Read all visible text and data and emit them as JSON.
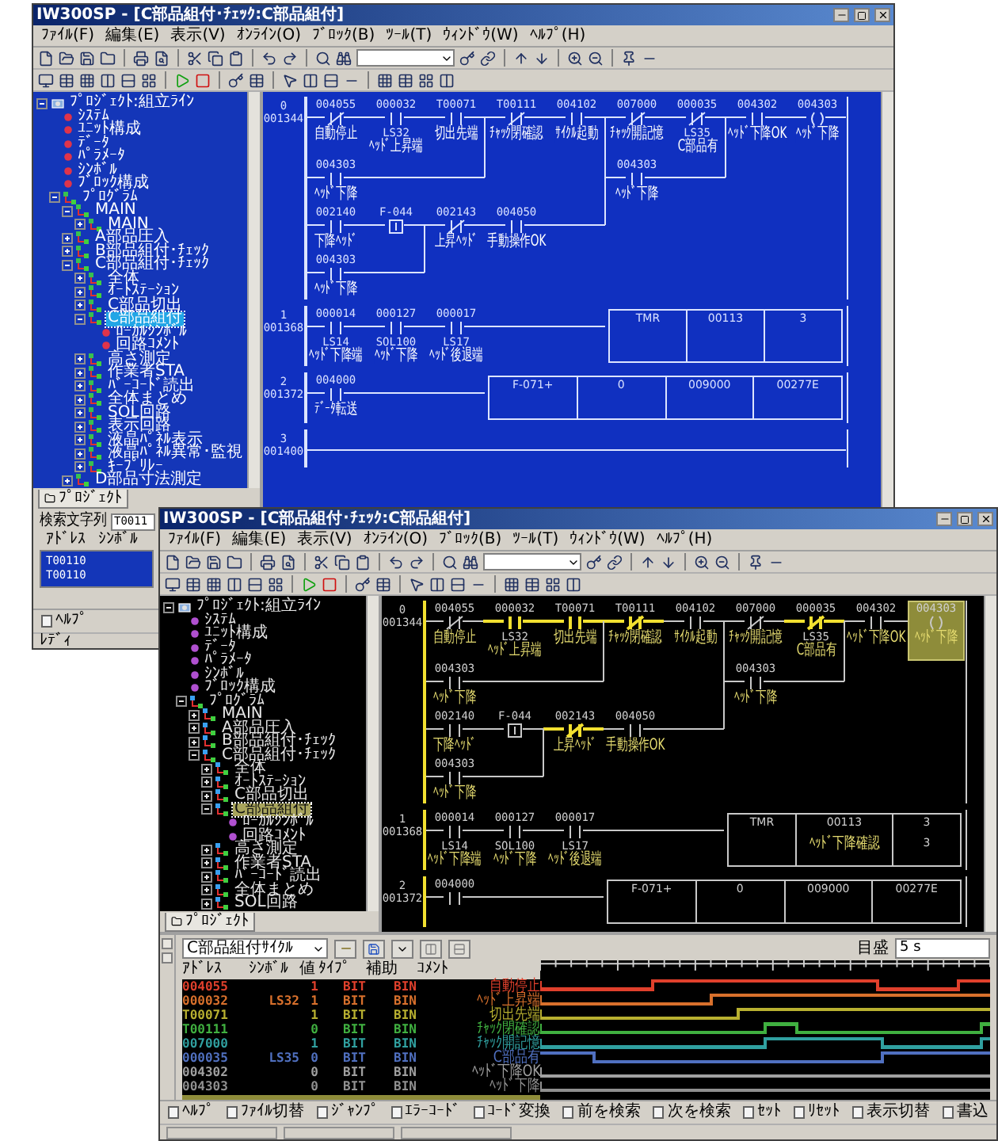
{
  "back": {
    "title": "IW300SP - [C部品組付･ﾁｪｯｸ:C部品組付]",
    "menu": [
      "ﾌｧｲﾙ(F)",
      "編集(E)",
      "表示(V)",
      "ｵﾝﾗｲﾝ(O)",
      "ﾌﾞﾛｯｸ(B)",
      "ﾂｰﾙ(T)",
      "ｳｨﾝﾄﾞｳ(W)",
      "ﾍﾙﾌﾟ(H)"
    ],
    "tree": {
      "label": "ﾌﾟﾛｼﾞｪｸﾄ:組立ﾗｲﾝ",
      "kind": "project",
      "expanded": true,
      "selected": false,
      "children": [
        {
          "label": "ｼｽﾃﾑ",
          "kind": "doc",
          "selected": false
        },
        {
          "label": "ﾕﾆｯﾄ構成",
          "kind": "doc",
          "selected": false
        },
        {
          "label": "ﾃﾞｰﾀ",
          "kind": "doc",
          "selected": false
        },
        {
          "label": "ﾊﾟﾗﾒｰﾀ",
          "kind": "doc",
          "selected": false
        },
        {
          "label": "ｼﾝﾎﾞﾙ",
          "kind": "doc",
          "selected": false
        },
        {
          "label": "ﾌﾞﾛｯｸ構成",
          "kind": "doc",
          "selected": false
        },
        {
          "label": "ﾌﾟﾛｸﾞﾗﾑ",
          "kind": "block",
          "expanded": true,
          "selected": false,
          "children": [
            {
              "label": "MAIN",
              "kind": "block",
              "expanded": true,
              "selected": false,
              "children": [
                {
                  "label": "MAIN",
                  "kind": "block",
                  "expanded": false,
                  "selected": false
                }
              ]
            },
            {
              "label": "A部品圧入",
              "kind": "block",
              "expanded": false,
              "selected": false
            },
            {
              "label": "B部品組付･ﾁｪｯｸ",
              "kind": "block",
              "expanded": false,
              "selected": false
            },
            {
              "label": "C部品組付･ﾁｪｯｸ",
              "kind": "block",
              "expanded": true,
              "selected": false,
              "children": [
                {
                  "label": "全体",
                  "kind": "block",
                  "expanded": false,
                  "selected": false
                },
                {
                  "label": "ｵｰﾄｽﾃｰｼｮﾝ",
                  "kind": "block",
                  "expanded": false,
                  "selected": false
                },
                {
                  "label": "C部品切出",
                  "kind": "block",
                  "expanded": false,
                  "selected": false
                },
                {
                  "label": "C部品組付",
                  "kind": "block",
                  "expanded": true,
                  "selected": true,
                  "children": [
                    {
                      "label": "ﾛｰｶﾙｼﾝﾎﾞﾙ",
                      "kind": "doc",
                      "selected": false
                    },
                    {
                      "label": "回路ｺﾒﾝﾄ",
                      "kind": "doc",
                      "selected": false
                    }
                  ]
                },
                {
                  "label": "高さ測定",
                  "kind": "block",
                  "expanded": false,
                  "selected": false
                },
                {
                  "label": "作業者STA",
                  "kind": "block",
                  "expanded": false,
                  "selected": false
                },
                {
                  "label": "ﾊﾞｰｺｰﾄﾞ読出",
                  "kind": "block",
                  "expanded": false,
                  "selected": false
                },
                {
                  "label": "全体まとめ",
                  "kind": "block",
                  "expanded": false,
                  "selected": false
                },
                {
                  "label": "SOL回路",
                  "kind": "block",
                  "expanded": false,
                  "selected": false
                },
                {
                  "label": "表示回路",
                  "kind": "block",
                  "expanded": false,
                  "selected": false
                },
                {
                  "label": "液晶ﾊﾟﾈﾙ表示",
                  "kind": "block",
                  "expanded": false,
                  "selected": false
                },
                {
                  "label": "液晶ﾊﾟﾈﾙ異常･監視",
                  "kind": "block",
                  "expanded": false,
                  "selected": false
                },
                {
                  "label": "ｷｰﾌﾟﾘﾚｰ",
                  "kind": "block",
                  "expanded": false,
                  "selected": false
                }
              ]
            },
            {
              "label": "D部品寸法測定",
              "kind": "block",
              "expanded": false,
              "selected": false
            }
          ]
        }
      ]
    },
    "tab": "ﾌﾟﾛｼﾞｪｸﾄ",
    "ladder": {
      "rungs": [
        {
          "step": "0",
          "address": "001344",
          "powered": false,
          "elements": [
            {
              "kind": "nc",
              "address": "004055",
              "label": "自動停止",
              "energized": false,
              "selected": false
            },
            {
              "kind": "no",
              "address": "000032",
              "symbol": "LS32",
              "label": "ﾍｯﾄﾞ上昇端",
              "energized": false,
              "selected": false
            },
            {
              "kind": "no",
              "address": "T00071",
              "label": "切出先端",
              "energized": false,
              "selected": false
            },
            {
              "kind": "nc",
              "address": "T00111",
              "label": "ﾁｬｯｸ閉確認",
              "energized": false,
              "selected": false
            },
            {
              "kind": "no",
              "address": "004102",
              "label": "ｻｲｸﾙ起動",
              "energized": false,
              "selected": false
            },
            {
              "kind": "nc",
              "address": "007000",
              "label": "ﾁｬｯｸ開記憶",
              "energized": false,
              "selected": false
            },
            {
              "kind": "nc",
              "address": "000035",
              "symbol": "LS35",
              "label": "C部品有",
              "energized": false,
              "selected": false
            },
            {
              "kind": "no",
              "address": "004302",
              "label": "ﾍｯﾄﾞ下降OK",
              "energized": false,
              "selected": false
            },
            {
              "kind": "coil",
              "address": "004303",
              "label": "ﾍｯﾄﾞ下降",
              "energized": false,
              "selected": false
            },
            {
              "kind": "no",
              "address": "004303",
              "label": "ﾍｯﾄﾞ下降",
              "energized": false,
              "selected": false
            },
            {
              "kind": "no",
              "address": "004303",
              "label": "ﾍｯﾄﾞ下降",
              "energized": false,
              "selected": false
            },
            {
              "kind": "no",
              "address": "002140",
              "label": "下降ﾍｯﾄﾞ",
              "energized": false,
              "selected": false
            },
            {
              "kind": "fn",
              "address": "F-044",
              "energized": false,
              "selected": false
            },
            {
              "kind": "nc",
              "address": "002143",
              "label": "上昇ﾍｯﾄﾞ",
              "energized": false,
              "selected": false
            },
            {
              "kind": "no",
              "address": "004050",
              "label": "手動操作OK",
              "energized": false,
              "selected": false
            },
            {
              "kind": "no",
              "address": "004303",
              "label": "ﾍｯﾄﾞ下降",
              "energized": false,
              "selected": false
            }
          ]
        },
        {
          "step": "1",
          "address": "001368",
          "powered": false,
          "elements": [
            {
              "kind": "no",
              "address": "000014",
              "symbol": "LS14",
              "label": "ﾍｯﾄﾞ下降端",
              "energized": false,
              "selected": false
            },
            {
              "kind": "no",
              "address": "000127",
              "symbol": "SOL100",
              "label": "ﾍｯﾄﾞ下降",
              "energized": false,
              "selected": false
            },
            {
              "kind": "no",
              "address": "000017",
              "symbol": "LS17",
              "label": "ﾍｯﾄﾞ後退端",
              "energized": false,
              "selected": false
            },
            {
              "kind": "box",
              "cells": [
                [
                  "TMR"
                ],
                [
                  "00113"
                ],
                [
                  "3"
                ]
              ]
            }
          ]
        },
        {
          "step": "2",
          "address": "001372",
          "powered": false,
          "elements": [
            {
              "kind": "no",
              "address": "004000",
              "label": "ﾃﾞｰﾀ転送",
              "energized": false,
              "selected": false
            },
            {
              "kind": "box",
              "cells": [
                [
                  "F-071+"
                ],
                [
                  "0"
                ],
                [
                  "009000"
                ],
                [
                  "00277E"
                ]
              ]
            }
          ]
        },
        {
          "step": "3",
          "address": "001400",
          "powered": false
        }
      ]
    },
    "search": {
      "label": "検索文字列",
      "value": "T0011"
    },
    "result_columns": [
      "ｱﾄﾞﾚｽ",
      "ｼﾝﾎﾞﾙ"
    ],
    "results": [
      "T00110",
      "T00110"
    ],
    "fkeys": [
      "ﾍﾙﾌﾟ"
    ],
    "status": "ﾚﾃﾞｨ"
  },
  "front": {
    "title": "IW300SP - [C部品組付･ﾁｪｯｸ:C部品組付]",
    "menu": [
      "ﾌｧｲﾙ(F)",
      "編集(E)",
      "表示(V)",
      "ｵﾝﾗｲﾝ(O)",
      "ﾌﾞﾛｯｸ(B)",
      "ﾂｰﾙ(T)",
      "ｳｨﾝﾄﾞｳ(W)",
      "ﾍﾙﾌﾟ(H)"
    ],
    "tree": {
      "label": "ﾌﾟﾛｼﾞｪｸﾄ:組立ﾗｲﾝ",
      "kind": "project",
      "expanded": true,
      "selected": false,
      "children": [
        {
          "label": "ｼｽﾃﾑ",
          "kind": "doc",
          "selected": false
        },
        {
          "label": "ﾕﾆｯﾄ構成",
          "kind": "doc",
          "selected": false
        },
        {
          "label": "ﾃﾞｰﾀ",
          "kind": "doc",
          "selected": false
        },
        {
          "label": "ﾊﾟﾗﾒｰﾀ",
          "kind": "doc",
          "selected": false
        },
        {
          "label": "ｼﾝﾎﾞﾙ",
          "kind": "doc",
          "selected": false
        },
        {
          "label": "ﾌﾞﾛｯｸ構成",
          "kind": "doc",
          "selected": false
        },
        {
          "label": "ﾌﾟﾛｸﾞﾗﾑ",
          "kind": "block",
          "expanded": true,
          "selected": false,
          "children": [
            {
              "label": "MAIN",
              "kind": "block",
              "expanded": false,
              "selected": false
            },
            {
              "label": "A部品圧入",
              "kind": "block",
              "expanded": false,
              "selected": false
            },
            {
              "label": "B部品組付･ﾁｪｯｸ",
              "kind": "block",
              "expanded": false,
              "selected": false
            },
            {
              "label": "C部品組付･ﾁｪｯｸ",
              "kind": "block",
              "expanded": true,
              "selected": false,
              "children": [
                {
                  "label": "全体",
                  "kind": "block",
                  "expanded": false,
                  "selected": false
                },
                {
                  "label": "ｵｰﾄｽﾃｰｼｮﾝ",
                  "kind": "block",
                  "expanded": false,
                  "selected": false
                },
                {
                  "label": "C部品切出",
                  "kind": "block",
                  "expanded": false,
                  "selected": false
                },
                {
                  "label": "C部品組付",
                  "kind": "block",
                  "expanded": true,
                  "selected": true,
                  "children": [
                    {
                      "label": "ﾛｰｶﾙｼﾝﾎﾞﾙ",
                      "kind": "doc",
                      "selected": false
                    },
                    {
                      "label": "回路ｺﾒﾝﾄ",
                      "kind": "doc",
                      "selected": false
                    }
                  ]
                },
                {
                  "label": "高さ測定",
                  "kind": "block",
                  "expanded": false,
                  "selected": false
                },
                {
                  "label": "作業者STA",
                  "kind": "block",
                  "expanded": false,
                  "selected": false
                },
                {
                  "label": "ﾊﾞｰｺｰﾄﾞ読出",
                  "kind": "block",
                  "expanded": false,
                  "selected": false
                },
                {
                  "label": "全体まとめ",
                  "kind": "block",
                  "expanded": false,
                  "selected": false
                },
                {
                  "label": "SOL回路",
                  "kind": "block",
                  "expanded": false,
                  "selected": false
                }
              ]
            }
          ]
        }
      ]
    },
    "tab": "ﾌﾟﾛｼﾞｪｸﾄ",
    "ladder": {
      "rungs": [
        {
          "step": "0",
          "address": "001344",
          "powered": true,
          "elements": [
            {
              "kind": "nc",
              "address": "004055",
              "label": "自動停止",
              "energized": false,
              "selected": false
            },
            {
              "kind": "no",
              "address": "000032",
              "symbol": "LS32",
              "label": "ﾍｯﾄﾞ上昇端",
              "energized": true,
              "selected": false
            },
            {
              "kind": "no",
              "address": "T00071",
              "label": "切出先端",
              "energized": true,
              "selected": false
            },
            {
              "kind": "nc",
              "address": "T00111",
              "label": "ﾁｬｯｸ閉確認",
              "energized": true,
              "selected": false
            },
            {
              "kind": "no",
              "address": "004102",
              "label": "ｻｲｸﾙ起動",
              "energized": false,
              "selected": false
            },
            {
              "kind": "nc",
              "address": "007000",
              "label": "ﾁｬｯｸ開記憶",
              "energized": false,
              "selected": false
            },
            {
              "kind": "nc",
              "address": "000035",
              "symbol": "LS35",
              "label": "C部品有",
              "energized": true,
              "selected": false
            },
            {
              "kind": "no",
              "address": "004302",
              "label": "ﾍｯﾄﾞ下降OK",
              "energized": false,
              "selected": false
            },
            {
              "kind": "coil",
              "address": "004303",
              "label": "ﾍｯﾄﾞ下降",
              "energized": false,
              "selected": true
            },
            {
              "kind": "no",
              "address": "004303",
              "label": "ﾍｯﾄﾞ下降",
              "energized": false,
              "selected": false
            },
            {
              "kind": "no",
              "address": "004303",
              "label": "ﾍｯﾄﾞ下降",
              "energized": false,
              "selected": false
            },
            {
              "kind": "no",
              "address": "002140",
              "label": "下降ﾍｯﾄﾞ",
              "energized": false,
              "selected": false
            },
            {
              "kind": "fn",
              "address": "F-044",
              "energized": false,
              "selected": false
            },
            {
              "kind": "nc",
              "address": "002143",
              "label": "上昇ﾍｯﾄﾞ",
              "energized": true,
              "selected": false
            },
            {
              "kind": "no",
              "address": "004050",
              "label": "手動操作OK",
              "energized": false,
              "selected": false
            },
            {
              "kind": "no",
              "address": "004303",
              "label": "ﾍｯﾄﾞ下降",
              "energized": false,
              "selected": false
            }
          ]
        },
        {
          "step": "1",
          "address": "001368",
          "powered": true,
          "elements": [
            {
              "kind": "no",
              "address": "000014",
              "symbol": "LS14",
              "label": "ﾍｯﾄﾞ下降端",
              "energized": false,
              "selected": false
            },
            {
              "kind": "no",
              "address": "000127",
              "symbol": "SOL100",
              "label": "ﾍｯﾄﾞ下降",
              "energized": false,
              "selected": false
            },
            {
              "kind": "no",
              "address": "000017",
              "symbol": "LS17",
              "label": "ﾍｯﾄﾞ後退端",
              "energized": false,
              "selected": false
            },
            {
              "kind": "box",
              "cells": [
                [
                  "TMR"
                ],
                [
                  "00113",
                  "ﾍｯﾄﾞ下降確認"
                ],
                [
                  "3",
                  "3"
                ]
              ]
            }
          ]
        },
        {
          "step": "2",
          "address": "001372",
          "powered": true,
          "elements": [
            {
              "kind": "no",
              "address": "004000",
              "energized": false,
              "selected": false
            },
            {
              "kind": "box",
              "cells": [
                [
                  "F-071+"
                ],
                [
                  "0"
                ],
                [
                  "009000"
                ],
                [
                  "00277E"
                ]
              ]
            }
          ]
        }
      ]
    },
    "monitor": {
      "group": "C部品組付ｻｲｸﾙ",
      "scale_label": "目盛",
      "scale_value": "5 s",
      "columns": [
        "ｱﾄﾞﾚｽ",
        "ｼﾝﾎﾞﾙ",
        "値",
        "ﾀｲﾌﾟ",
        "補助",
        "ｺﾒﾝﾄ"
      ],
      "rows": [
        {
          "address": "004055",
          "value": "1",
          "type": "BIT",
          "aux": "BIN",
          "comment": "自動停止",
          "color": "#e0402c"
        },
        {
          "address": "000032",
          "symbol": "LS32",
          "value": "1",
          "type": "BIT",
          "aux": "BIN",
          "comment": "ﾍｯﾄﾞ上昇端",
          "color": "#d8702c"
        },
        {
          "address": "T00071",
          "value": "1",
          "type": "BIT",
          "aux": "BIN",
          "comment": "切出先端",
          "color": "#b8b030"
        },
        {
          "address": "T00111",
          "value": "0",
          "type": "BIT",
          "aux": "BIN",
          "comment": "ﾁｬｯｸ閉確認",
          "color": "#40b040"
        },
        {
          "address": "007000",
          "value": "1",
          "type": "BIT",
          "aux": "BIN",
          "comment": "ﾁｬｯｸ開記憶",
          "color": "#30a0a0"
        },
        {
          "address": "000035",
          "symbol": "LS35",
          "value": "0",
          "type": "BIT",
          "aux": "BIN",
          "comment": "C部品有",
          "color": "#5070c0"
        },
        {
          "address": "004302",
          "value": "0",
          "type": "BIT",
          "aux": "BIN",
          "comment": "ﾍｯﾄﾞ下降OK",
          "color": "#a0a0a0"
        },
        {
          "address": "004303",
          "value": "0",
          "type": "BIT",
          "aux": "BIN",
          "comment": "ﾍｯﾄﾞ下降",
          "color": "#909090"
        }
      ]
    },
    "fkeys": [
      "ﾍﾙﾌﾟ",
      "ﾌｧｲﾙ切替",
      "ｼﾞｬﾝﾌﾟ",
      "ｴﾗｰｺｰﾄﾞ",
      "ｺｰﾄﾞ変換",
      "前を検索",
      "次を検索",
      "ｾｯﾄ",
      "ﾘｾｯﾄ",
      "表示切替",
      "書込"
    ]
  }
}
